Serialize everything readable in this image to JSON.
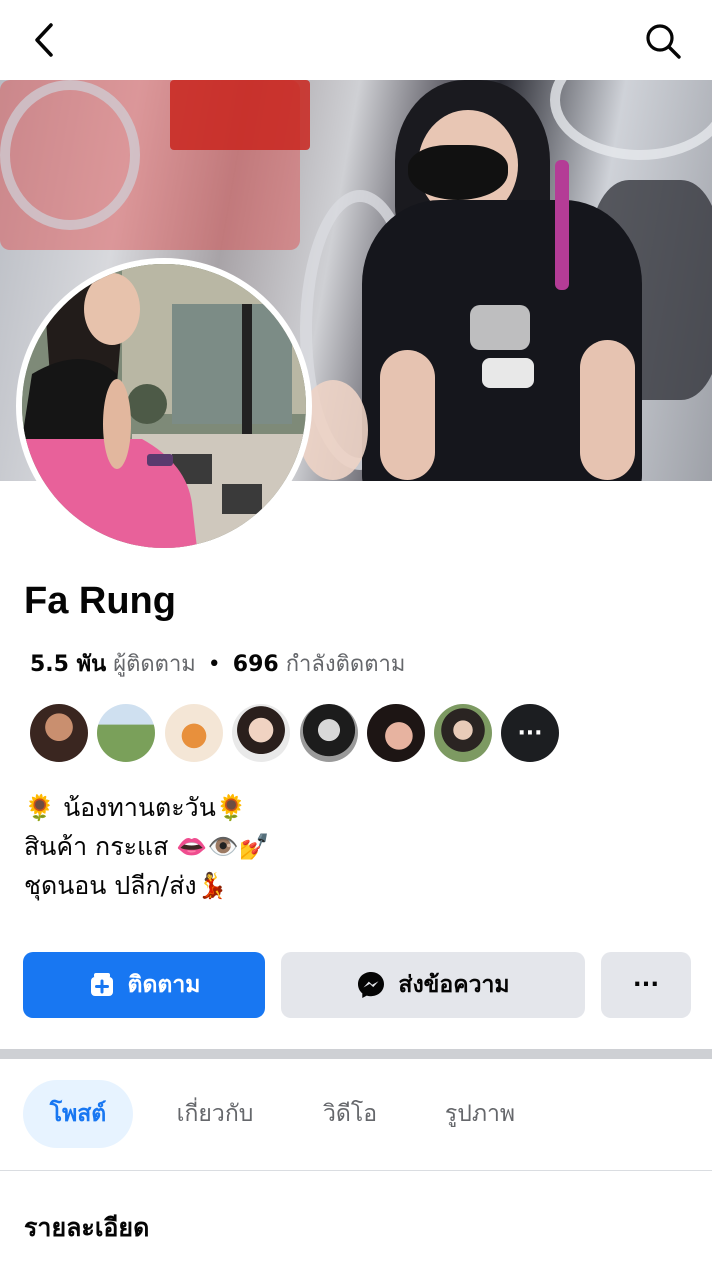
{
  "profile": {
    "name": "Fa Rung",
    "followers_count": "5.5 พัน",
    "followers_label": "ผู้ติดตาม",
    "following_count": "696",
    "following_label": "กำลังติดตาม",
    "bio": {
      "line1": "🌻 น้องทานตะวัน🌻",
      "line2": "สินค้า กระแส  👄👁️💅",
      "line3": "ชุดนอน ปลีก/ส่ง💃"
    }
  },
  "friends": {
    "more_label": "···"
  },
  "actions": {
    "follow_label": "ติดตาม",
    "message_label": "ส่งข้อความ",
    "more_label": "···"
  },
  "tabs": [
    {
      "label": "โพสต์"
    },
    {
      "label": "เกี่ยวกับ"
    },
    {
      "label": "วิดีโอ"
    },
    {
      "label": "รูปภาพ"
    }
  ],
  "section": {
    "details_title": "รายละเอียด"
  },
  "colors": {
    "accent": "#1877f2",
    "tab_active_bg": "#e7f3ff",
    "button_secondary": "#e4e6eb",
    "text_secondary": "#65676b"
  },
  "icons": {
    "back": "chevron-left-icon",
    "search": "search-icon",
    "follow": "follow-icon",
    "messenger": "messenger-icon"
  }
}
